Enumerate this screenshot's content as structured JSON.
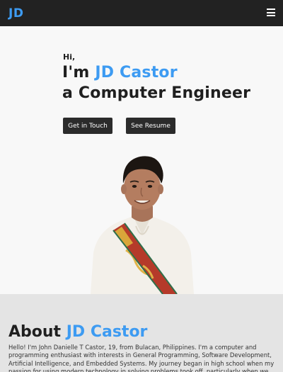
{
  "navbar": {
    "logo": "JD",
    "menu_icon": "hamburger-menu-icon"
  },
  "hero": {
    "greeting": "Hi,",
    "line1_prefix": "I'm ",
    "line1_name": "JD Castor",
    "line2": "a Computer Engineer",
    "buttons": {
      "touch": "Get in Touch",
      "resume": "See Resume"
    }
  },
  "about": {
    "title_prefix": "About ",
    "title_name": "JD Castor",
    "body": "Hello! I'm John Danielle T Castor, 19, from Bulacan, Philippines. I'm a computer and programming enthusiast with interests in General Programming, Software Development, Artificial Intelligence, and Embedded Systems. My journey began in high school when my passion for using modern technology in solving problems took off, particularly when we developed an Augmented Reality-"
  },
  "colors": {
    "accent": "#3d9bf2",
    "navbar": "#222222",
    "button": "#2b2b2b",
    "about_bg": "#e4e4e4"
  }
}
